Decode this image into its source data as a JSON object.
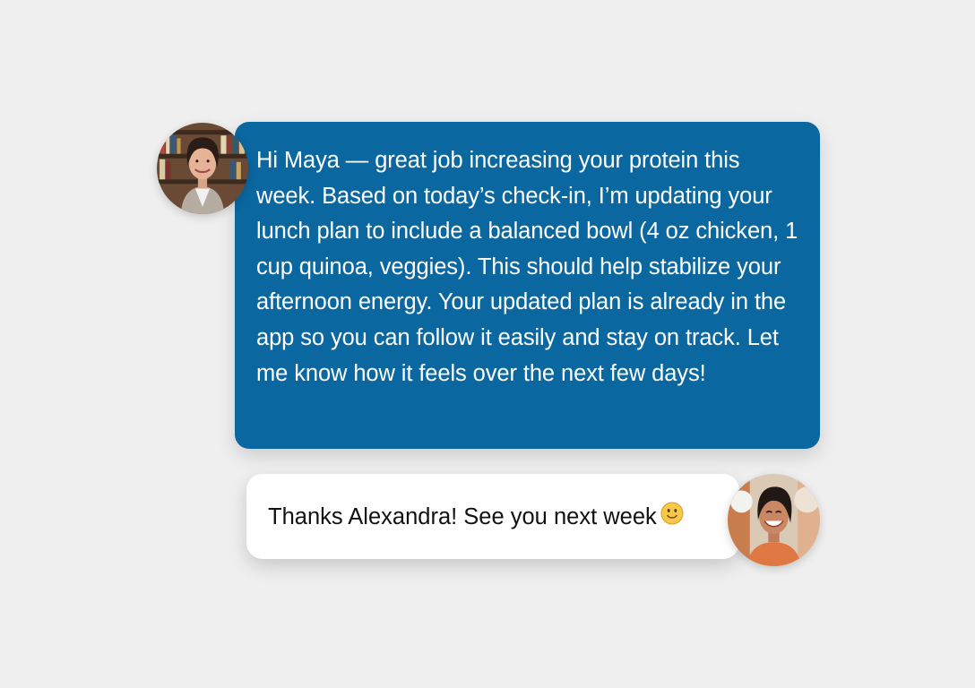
{
  "conversation": {
    "coach": {
      "avatar_icon": "coach-avatar",
      "message": "Hi Maya — great job increasing your protein this week. Based on today’s check-in, I’m updating your lunch plan to include a balanced bowl (4 oz chicken, 1 cup quinoa, veggies). This should help stabilize your afternoon energy. Your updated plan is already in the app so you can follow it easily and stay on track. Let me know how it feels over the next few days!"
    },
    "client": {
      "avatar_icon": "client-avatar",
      "message": "Thanks Alexandra! See you next week",
      "emoji_icon": "slightly-smiling-face-icon"
    }
  },
  "colors": {
    "background": "#efefef",
    "coach_bubble": "#0b67a0",
    "client_bubble": "#ffffff"
  }
}
